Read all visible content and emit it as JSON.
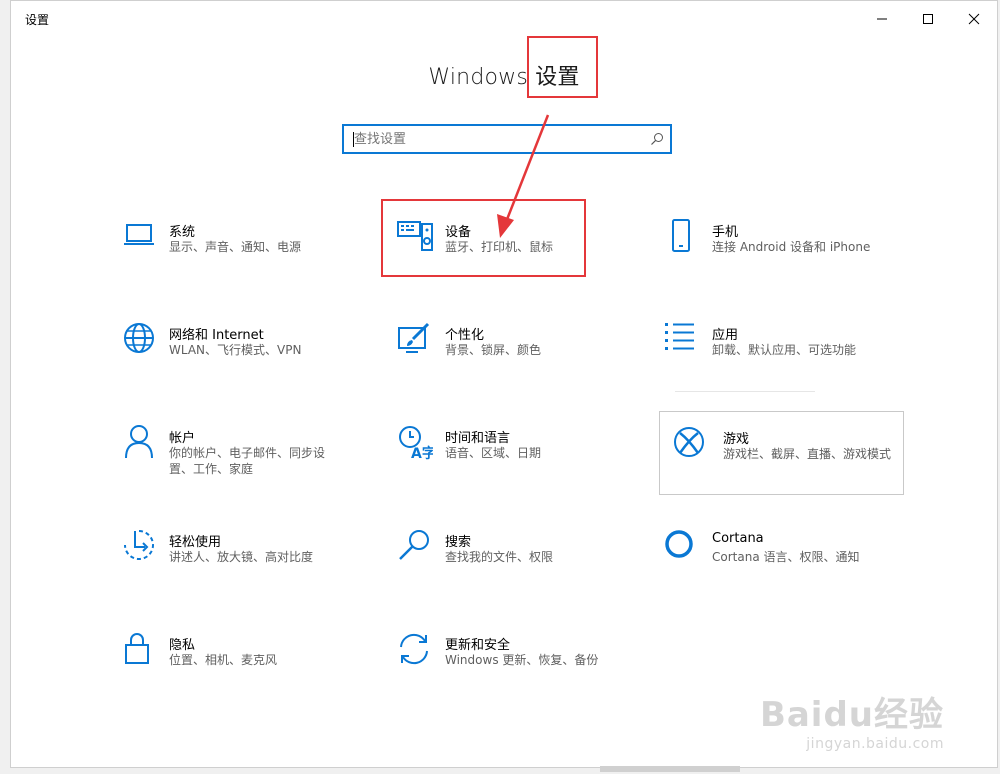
{
  "window": {
    "title": "设置"
  },
  "header": {
    "title": "Windows 设置"
  },
  "search": {
    "placeholder": "查找设置"
  },
  "tiles": {
    "system": {
      "title": "系统",
      "subtitle": "显示、声音、通知、电源"
    },
    "devices": {
      "title": "设备",
      "subtitle": "蓝牙、打印机、鼠标"
    },
    "phone": {
      "title": "手机",
      "subtitle": "连接 Android 设备和 iPhone"
    },
    "network": {
      "title": "网络和 Internet",
      "subtitle": "WLAN、飞行模式、VPN"
    },
    "personalization": {
      "title": "个性化",
      "subtitle": "背景、锁屏、颜色"
    },
    "apps": {
      "title": "应用",
      "subtitle": "卸载、默认应用、可选功能"
    },
    "accounts": {
      "title": "帐户",
      "subtitle": "你的帐户、电子邮件、同步设置、工作、家庭"
    },
    "time": {
      "title": "时间和语言",
      "subtitle": "语音、区域、日期"
    },
    "gaming": {
      "title": "游戏",
      "subtitle": "游戏栏、截屏、直播、游戏模式"
    },
    "ease": {
      "title": "轻松使用",
      "subtitle": "讲述人、放大镜、高对比度"
    },
    "searchtile": {
      "title": "搜索",
      "subtitle": "查找我的文件、权限"
    },
    "cortana": {
      "title": "Cortana",
      "subtitle": "Cortana 语言、权限、通知"
    },
    "privacy": {
      "title": "隐私",
      "subtitle": "位置、相机、麦克风"
    },
    "update": {
      "title": "更新和安全",
      "subtitle": "Windows 更新、恢复、备份"
    }
  },
  "watermark": {
    "logo": "Baidu经验",
    "url": "jingyan.baidu.com"
  },
  "colors": {
    "accent": "#0a78d4",
    "annotation": "#e4373a"
  },
  "icons": {
    "system": "laptop-icon",
    "devices": "keyboard-speaker-icon",
    "phone": "phone-icon",
    "network": "globe-icon",
    "personalization": "paint-brush-icon",
    "apps": "app-list-icon",
    "accounts": "person-icon",
    "time": "time-language-icon",
    "gaming": "xbox-icon",
    "ease": "ease-of-access-icon",
    "searchtile": "magnifier-icon",
    "cortana": "cortana-circle-icon",
    "privacy": "lock-icon",
    "update": "refresh-arrows-icon"
  }
}
